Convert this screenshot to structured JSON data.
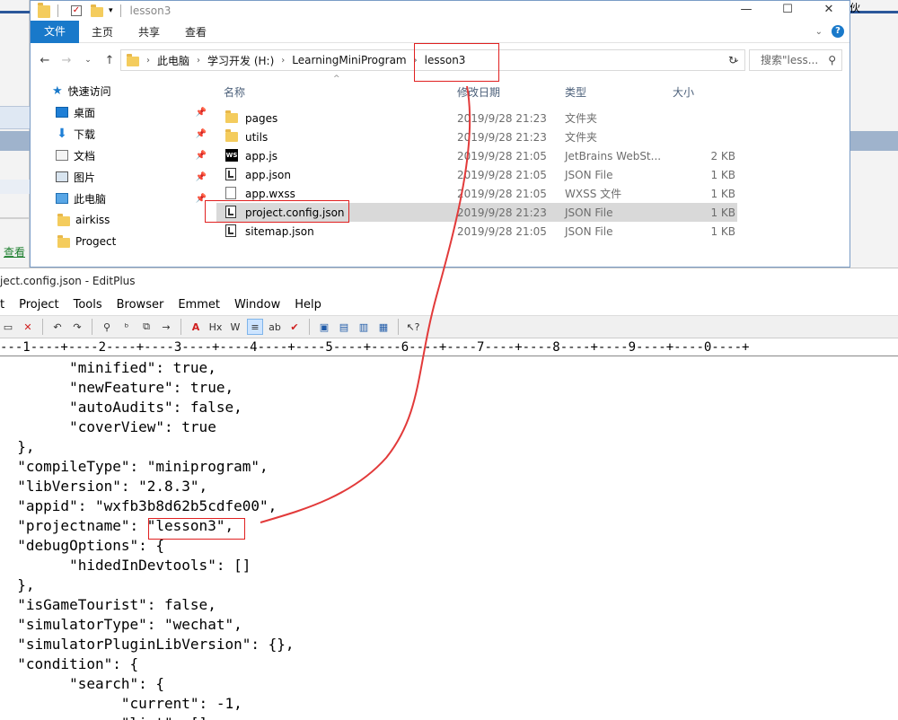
{
  "explorer": {
    "title": "lesson3",
    "ribbon": {
      "file": "文件",
      "tabs": [
        "主页",
        "共享",
        "查看"
      ]
    },
    "address": {
      "crumbs": [
        "此电脑",
        "学习开发 (H:)",
        "LearningMiniProgram",
        "lesson3"
      ]
    },
    "search_placeholder": "搜索\"less...",
    "nav": [
      {
        "label": "快速访问",
        "icon": "star-icon",
        "pinned": false
      },
      {
        "label": "桌面",
        "icon": "desktop-icon",
        "pinned": true
      },
      {
        "label": "下载",
        "icon": "download-icon",
        "pinned": true
      },
      {
        "label": "文档",
        "icon": "document-icon",
        "pinned": true
      },
      {
        "label": "图片",
        "icon": "picture-icon",
        "pinned": true
      },
      {
        "label": "此电脑",
        "icon": "computer-icon",
        "pinned": true
      },
      {
        "label": "airkiss",
        "icon": "folder-icon",
        "pinned": false
      },
      {
        "label": "Progect",
        "icon": "folder-icon",
        "pinned": false
      }
    ],
    "columns": {
      "name": "名称",
      "date": "修改日期",
      "type": "类型",
      "size": "大小"
    },
    "files": [
      {
        "name": "pages",
        "date": "2019/9/28 21:23",
        "type": "文件夹",
        "size": "",
        "icon": "folder-icon"
      },
      {
        "name": "utils",
        "date": "2019/9/28 21:23",
        "type": "文件夹",
        "size": "",
        "icon": "folder-icon"
      },
      {
        "name": "app.js",
        "date": "2019/9/28 21:05",
        "type": "JetBrains WebSt...",
        "size": "2 KB",
        "icon": "webstorm-icon"
      },
      {
        "name": "app.json",
        "date": "2019/9/28 21:05",
        "type": "JSON File",
        "size": "1 KB",
        "icon": "json-file-icon"
      },
      {
        "name": "app.wxss",
        "date": "2019/9/28 21:05",
        "type": "WXSS 文件",
        "size": "1 KB",
        "icon": "file-icon"
      },
      {
        "name": "project.config.json",
        "date": "2019/9/28 21:23",
        "type": "JSON File",
        "size": "1 KB",
        "icon": "json-file-icon",
        "selected": true
      },
      {
        "name": "sitemap.json",
        "date": "2019/9/28 21:05",
        "type": "JSON File",
        "size": "1 KB",
        "icon": "json-file-icon"
      }
    ]
  },
  "background": {
    "left_link": "查看",
    "right_glyph": "伙"
  },
  "editplus": {
    "title": "ject.config.json - EditPlus",
    "menu": [
      "t",
      "Project",
      "Tools",
      "Browser",
      "Emmet",
      "Window",
      "Help"
    ],
    "ruler": "---1----+----2----+----3----+----4----+----5----+----6----+----7----+----8----+----9----+----0----+",
    "code_lines": [
      "        \"minified\": true,",
      "        \"newFeature\": true,",
      "        \"autoAudits\": false,",
      "        \"coverView\": true",
      "  },",
      "  \"compileType\": \"miniprogram\",",
      "  \"libVersion\": \"2.8.3\",",
      "  \"appid\": \"wxfb3b8d62b5cdfe00\",",
      "  \"projectname\": \"lesson3\",",
      "  \"debugOptions\": {",
      "        \"hidedInDevtools\": []",
      "  },",
      "  \"isGameTourist\": false,",
      "  \"simulatorType\": \"wechat\",",
      "  \"simulatorPluginLibVersion\": {},",
      "  \"condition\": {",
      "        \"search\": {",
      "              \"current\": -1,",
      "              \"list\": []"
    ]
  }
}
